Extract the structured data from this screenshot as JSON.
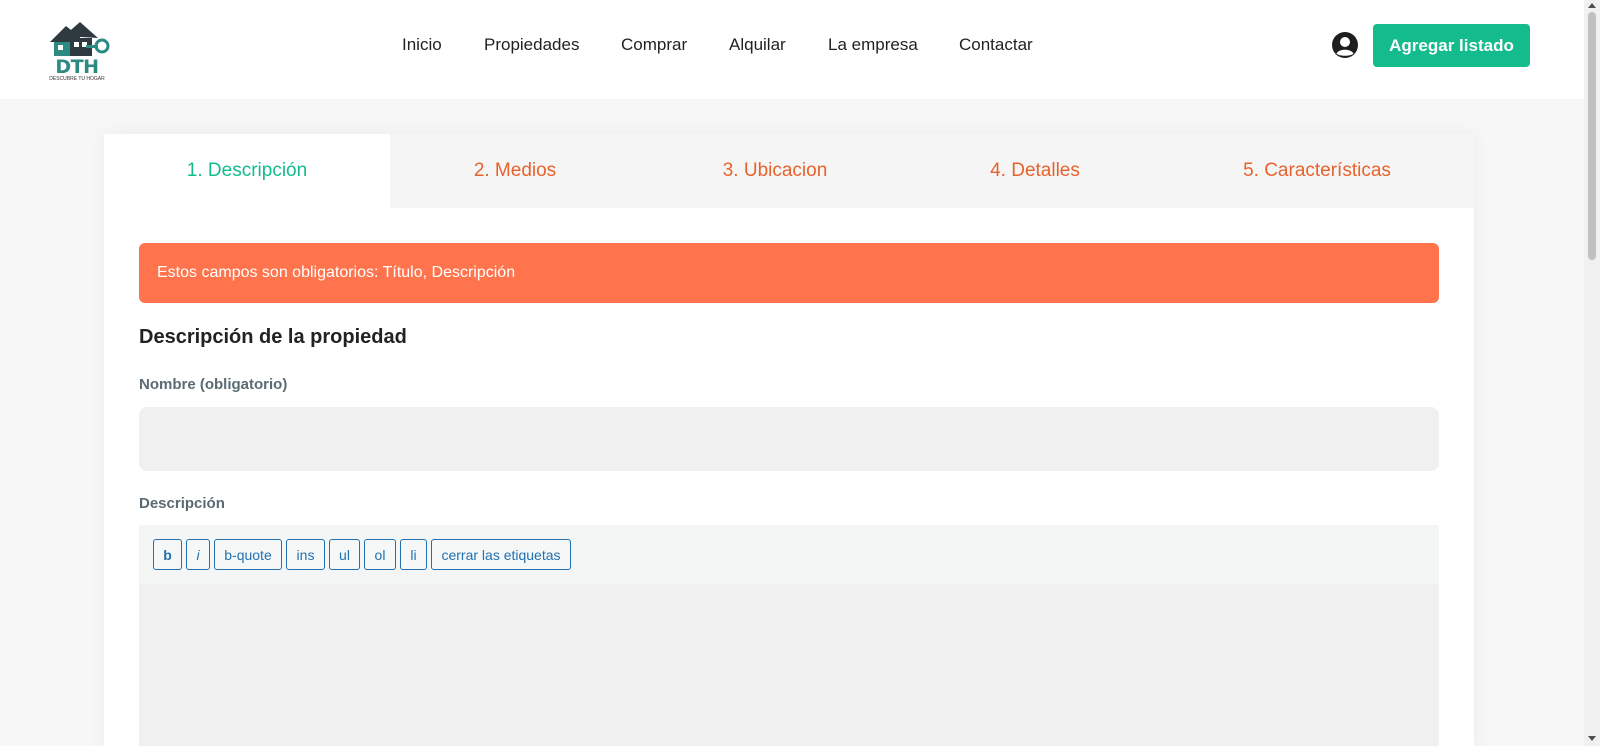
{
  "header": {
    "logo": {
      "text": "DTH",
      "tagline": "DESCUBRE TU HOGAR",
      "icon": "house-key-logo"
    },
    "nav": [
      {
        "label": "Inicio"
      },
      {
        "label": "Propiedades"
      },
      {
        "label": "Comprar"
      },
      {
        "label": "Alquilar"
      },
      {
        "label": "La empresa"
      },
      {
        "label": "Contactar"
      }
    ],
    "user_icon": "user-circle-icon",
    "add_listing_label": "Agregar listado"
  },
  "tabs": [
    {
      "label": "1. Descripción",
      "active": true
    },
    {
      "label": "2. Medios",
      "active": false
    },
    {
      "label": "3. Ubicacion",
      "active": false
    },
    {
      "label": "4. Detalles",
      "active": false
    },
    {
      "label": "5. Características",
      "active": false
    }
  ],
  "form": {
    "alert": "Estos campos son obligatorios: Título, Descripción",
    "section_title": "Descripción de la propiedad",
    "name_label": "Nombre (obligatorio)",
    "name_value": "",
    "description_label": "Descripción",
    "description_value": "",
    "toolbar": [
      "b",
      "i",
      "b-quote",
      "ins",
      "ul",
      "ol",
      "li",
      "cerrar las etiquetas"
    ]
  },
  "colors": {
    "accent": "#14bb8c",
    "tab_inactive": "#e8622c",
    "alert_bg": "#ff744c",
    "quicktag": "#2271b1"
  }
}
